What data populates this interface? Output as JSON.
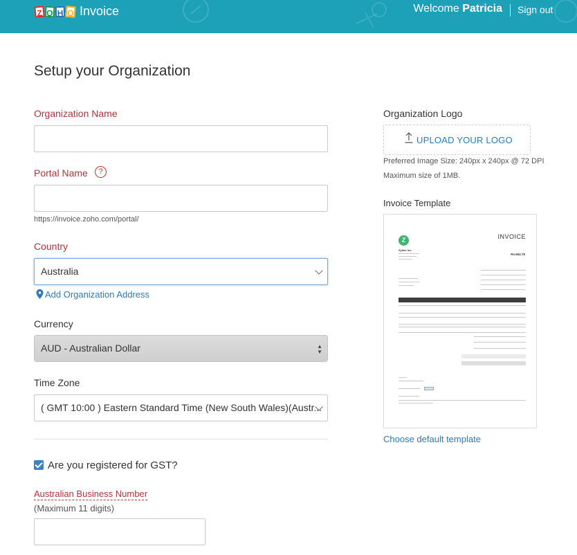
{
  "header": {
    "logo_letters": [
      "Z",
      "O",
      "H",
      "O"
    ],
    "logo_text": "Invoice",
    "welcome_prefix": "Welcome",
    "user_name": "Patricia",
    "signout_label": "Sign out",
    "bg_color": "#1da1b9"
  },
  "page": {
    "title": "Setup your Organization"
  },
  "form": {
    "org_name": {
      "label": "Organization Name",
      "value": ""
    },
    "portal_name": {
      "label": "Portal Name",
      "help_icon": "?",
      "value": "",
      "hint": "https://invoice.zoho.com/portal/"
    },
    "country": {
      "label": "Country",
      "value": "Australia"
    },
    "add_address_label": "Add Organization Address",
    "currency": {
      "label": "Currency",
      "value": "AUD - Australian Dollar"
    },
    "time_zone": {
      "label": "Time Zone",
      "value": "( GMT 10:00 ) Eastern Standard Time (New South Wales)(Austr..."
    },
    "gst": {
      "label": "Are you registered for GST?",
      "checked": true
    },
    "abn": {
      "label": "Australian Business Number",
      "hint": "(Maximum 11 digits)",
      "value": ""
    }
  },
  "logo_section": {
    "label": "Organization Logo",
    "upload_label": "UPLOAD YOUR LOGO",
    "size_hint": "Preferred Image Size: 240px x 240px @ 72 DPI",
    "max_hint": "Maximum size of 1MB."
  },
  "template_section": {
    "label": "Invoice Template",
    "preview_title": "INVOICE",
    "preview_logo_letter": "Z",
    "preview_company": "Zylker Inc",
    "preview_amount": "Rs.662.75",
    "default_link": "Choose default template"
  },
  "colors": {
    "required_label": "#b2343b",
    "link": "#2e7ab8",
    "accent_checkbox": "#3b82c4"
  }
}
